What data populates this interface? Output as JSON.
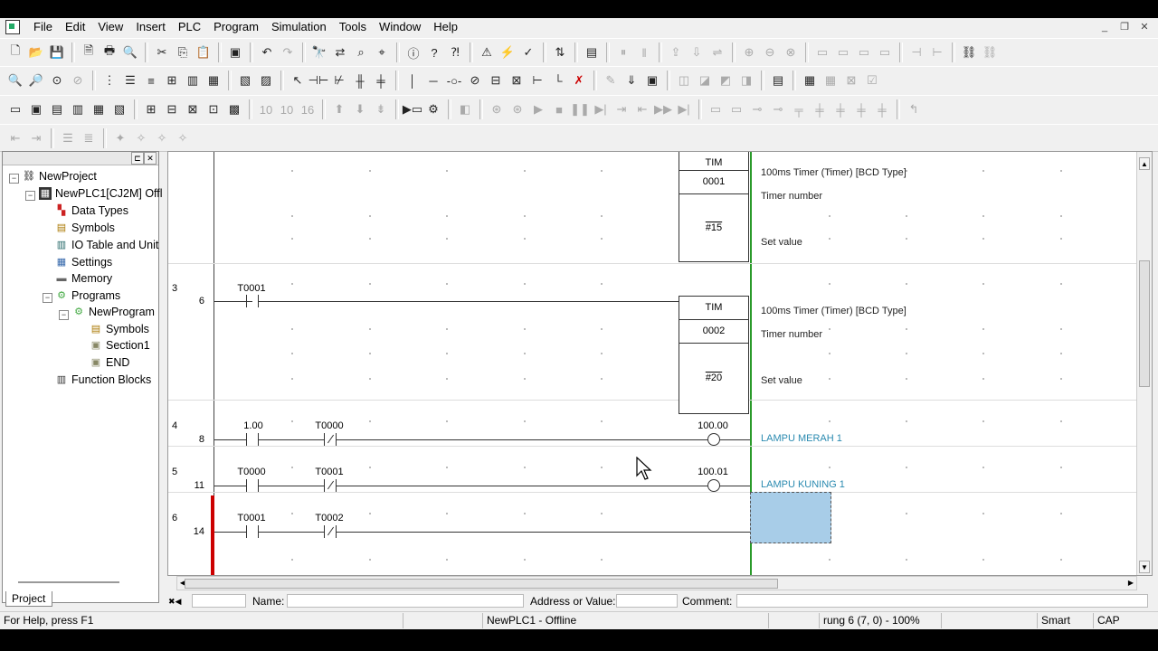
{
  "menu": [
    "File",
    "Edit",
    "View",
    "Insert",
    "PLC",
    "Program",
    "Simulation",
    "Tools",
    "Window",
    "Help"
  ],
  "project_tree": {
    "root": "NewProject",
    "plc": "NewPLC1[CJ2M] Offl",
    "items": [
      "Data Types",
      "Symbols",
      "IO Table and Unit",
      "Settings",
      "Memory",
      "Programs"
    ],
    "program": "NewProgram",
    "program_children": [
      "Symbols",
      "Section1",
      "END"
    ],
    "function_blocks": "Function Blocks",
    "tab": "Project"
  },
  "ladder": {
    "rung2": {
      "instr": "TIM",
      "timer": "0001",
      "setval": "#15",
      "desc": "100ms Timer (Timer) [BCD Type]",
      "timer_label": "Timer number",
      "set_label": "Set value"
    },
    "rung3": {
      "rung": "3",
      "step": "6",
      "contact": "T0001",
      "instr": "TIM",
      "timer": "0002",
      "setval": "#20",
      "desc": "100ms Timer (Timer) [BCD Type]",
      "timer_label": "Timer number",
      "set_label": "Set value"
    },
    "rung4": {
      "rung": "4",
      "step": "8",
      "c1": "1.00",
      "c2": "T0000",
      "coil": "100.00",
      "comment": "LAMPU MERAH 1"
    },
    "rung5": {
      "rung": "5",
      "step": "11",
      "c1": "T0000",
      "c2": "T0001",
      "coil": "100.01",
      "comment": "LAMPU KUNING 1"
    },
    "rung6": {
      "rung": "6",
      "step": "14",
      "c1": "T0001",
      "c2": "T0002"
    }
  },
  "infobar": {
    "name": "Name:",
    "address": "Address or Value:",
    "comment": "Comment:"
  },
  "status": {
    "help": "For Help, press F1",
    "plc": "NewPLC1 - Offline",
    "pos": "rung 6 (7, 0)  - 100%",
    "mode": "Smart",
    "caps": "CAP"
  }
}
